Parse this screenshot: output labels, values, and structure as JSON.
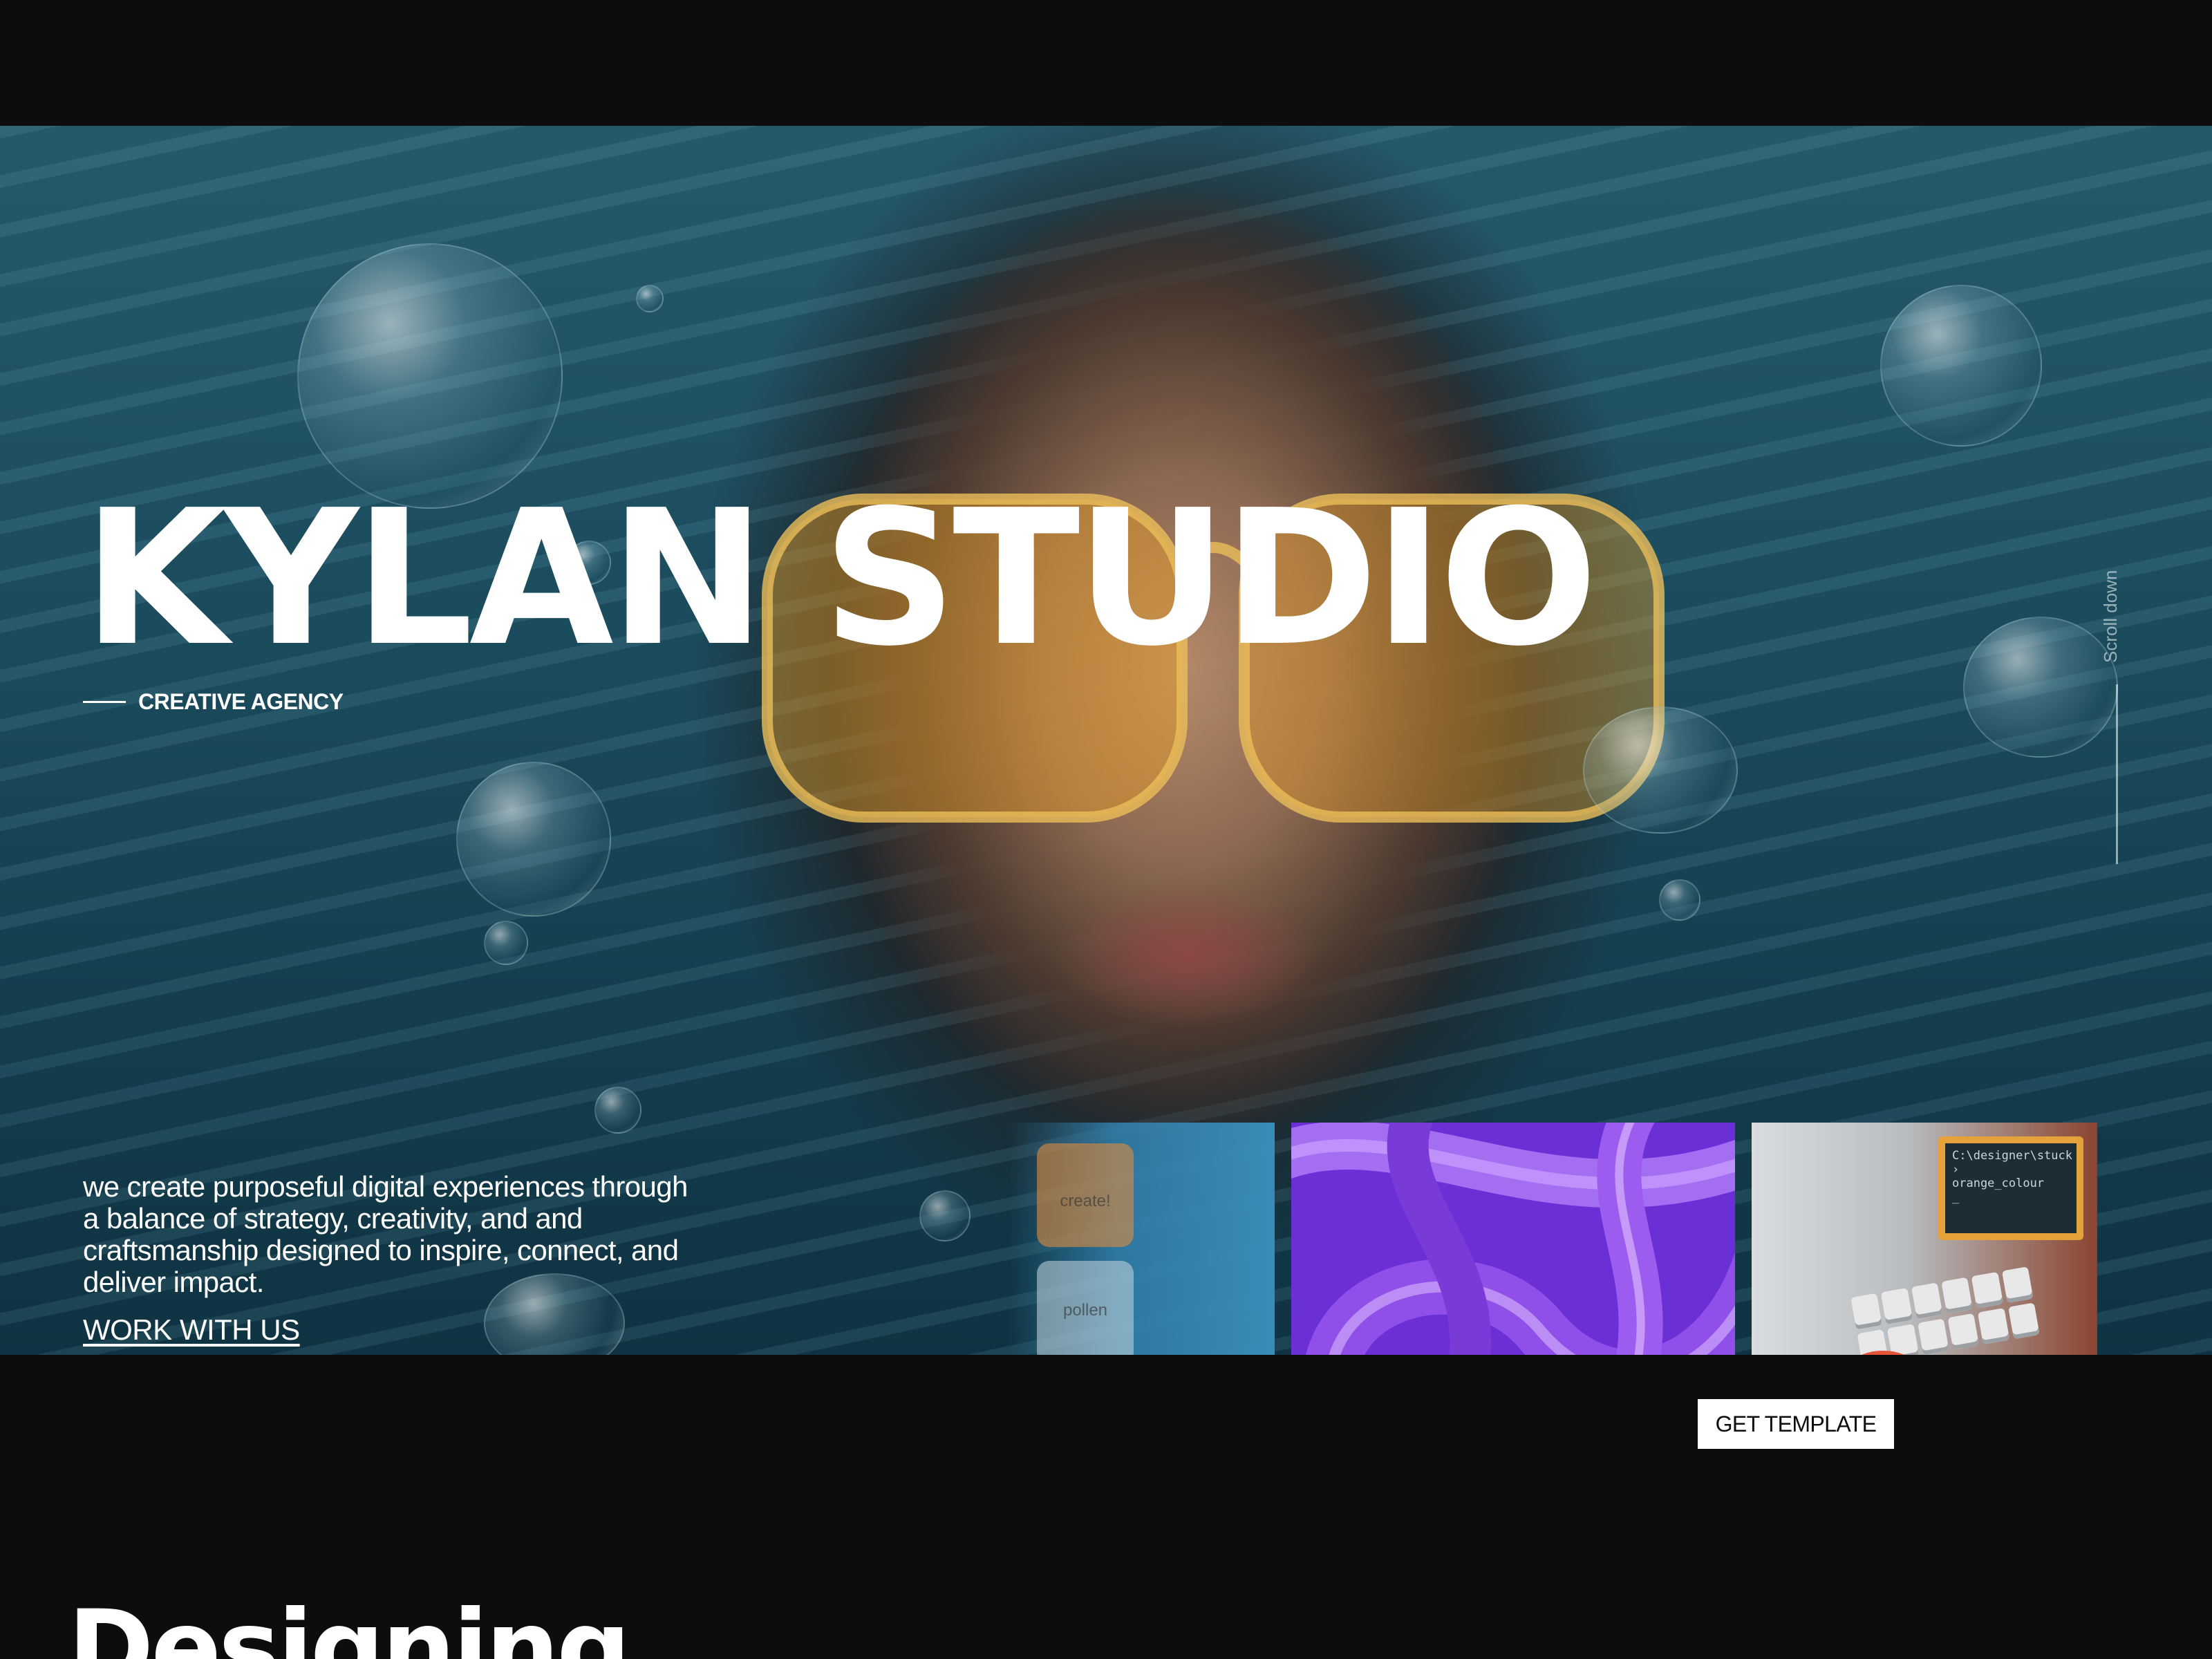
{
  "hero": {
    "title_word_1": "KYLAN",
    "title_word_2": "STUDIO",
    "tagline": "CREATIVE AGENCY",
    "scroll_label": "Scroll down",
    "intro_text": "we create purposeful digital experiences through a balance of strategy, creativity, and and craftsmanship designed to inspire, connect, and deliver impact.",
    "cta_link": "WORK WITH US"
  },
  "thumbnails": {
    "keys": [
      "create!",
      "pollen"
    ],
    "terminal_lines": [
      "C:\\designer\\stuck ›",
      "orange_colour",
      "_"
    ]
  },
  "actions": {
    "get_template": "GET TEMPLATE"
  },
  "next_section": {
    "heading": "Designing"
  },
  "colors": {
    "background": "#0d0c0e",
    "text": "#ffffff",
    "button_bg": "#ffffff",
    "button_text": "#0d0c0e"
  }
}
